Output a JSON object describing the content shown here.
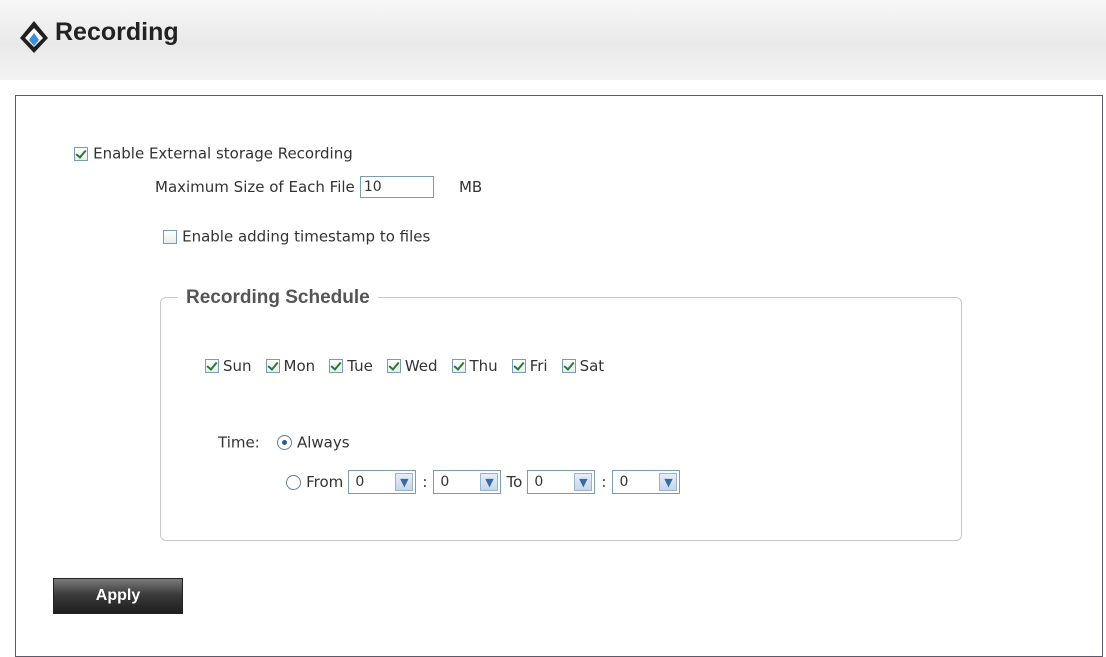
{
  "header": {
    "title": "Recording"
  },
  "enable_recording": {
    "label": "Enable External storage Recording",
    "checked": true
  },
  "max_size": {
    "label": "Maximum Size of Each File",
    "value": "10",
    "unit": "MB"
  },
  "timestamp": {
    "label": "Enable adding timestamp to files",
    "checked": false
  },
  "schedule": {
    "legend": "Recording Schedule",
    "days": [
      {
        "label": "Sun",
        "checked": true
      },
      {
        "label": "Mon",
        "checked": true
      },
      {
        "label": "Tue",
        "checked": true
      },
      {
        "label": "Wed",
        "checked": true
      },
      {
        "label": "Thu",
        "checked": true
      },
      {
        "label": "Fri",
        "checked": true
      },
      {
        "label": "Sat",
        "checked": true
      }
    ],
    "time_label": "Time:",
    "always_label": "Always",
    "always_selected": true,
    "from_label": "From",
    "to_label": "To",
    "colon": ":",
    "from_hour": "0",
    "from_minute": "0",
    "to_hour": "0",
    "to_minute": "0"
  },
  "apply_label": "Apply"
}
